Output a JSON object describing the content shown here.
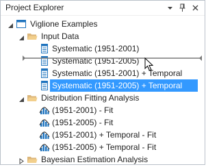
{
  "panel": {
    "title": "Project Explorer"
  },
  "titlebar_buttons": [
    {
      "name": "dropdown-arrow-icon",
      "glyph": "▾"
    },
    {
      "name": "pin-icon",
      "glyph": "📌"
    },
    {
      "name": "close-icon",
      "glyph": "✕"
    }
  ],
  "tree": {
    "root": {
      "label": "Viglione Examples",
      "icon": "project-icon"
    },
    "input_data": {
      "label": "Input Data",
      "icon": "folder-open-icon",
      "items": [
        {
          "label": "Systematic (1951-2001)",
          "icon": "dataset-icon"
        },
        {
          "label": "Systematic (1951-2005)",
          "icon": "dataset-icon"
        },
        {
          "label": "Systematic (1951-2001) + Temporal",
          "icon": "dataset-icon"
        },
        {
          "label": "Systematic (1951-2005) + Temporal",
          "icon": "dataset-icon",
          "selected": true
        }
      ]
    },
    "distribution_fitting": {
      "label": "Distribution Fitting Analysis",
      "icon": "folder-open-icon",
      "items": [
        {
          "label": "(1951-2001) - Fit",
          "icon": "chart-icon"
        },
        {
          "label": "(1951-2005) - Fit",
          "icon": "chart-icon"
        },
        {
          "label": "(1951-2001) + Temporal - Fit",
          "icon": "chart-icon"
        },
        {
          "label": "(1951-2005) + Temporal - Fit",
          "icon": "chart-icon"
        }
      ]
    },
    "bayesian": {
      "label": "Bayesian Estimation Analysis",
      "icon": "folder-open-icon"
    }
  },
  "colors": {
    "selection": "#3399ff",
    "folder": "#dcb67a",
    "accent_blue": "#1e73be",
    "dropline": "#7a7a7a"
  }
}
